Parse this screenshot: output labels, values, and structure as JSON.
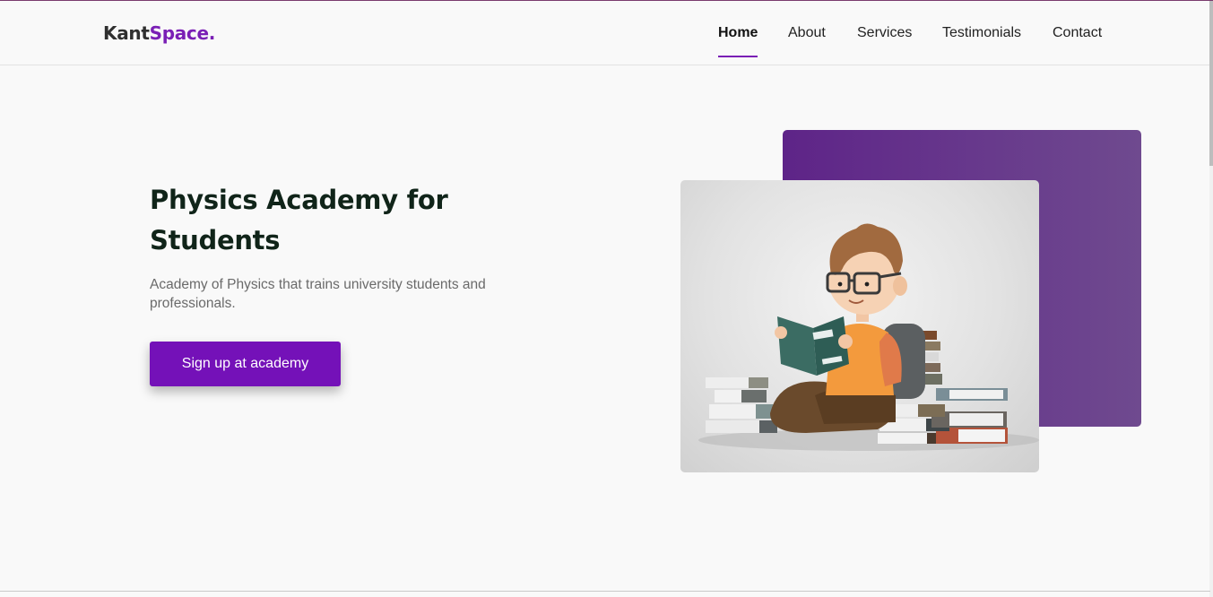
{
  "brand": {
    "part1": "Kant",
    "part2": "Space."
  },
  "nav": {
    "items": [
      {
        "label": "Home",
        "active": true
      },
      {
        "label": "About",
        "active": false
      },
      {
        "label": "Services",
        "active": false
      },
      {
        "label": "Testimonials",
        "active": false
      },
      {
        "label": "Contact",
        "active": false
      }
    ]
  },
  "hero": {
    "title": "Physics Academy for Students",
    "subtitle": "Academy of Physics that trains university students and professionals.",
    "cta_label": "Sign up at academy"
  },
  "colors": {
    "accent": "#7411b8",
    "logo_accent": "#7a1fb5",
    "title": "#102419",
    "panel": "#5e2488"
  },
  "illustration": {
    "icon": "student-reading-books-illustration"
  }
}
